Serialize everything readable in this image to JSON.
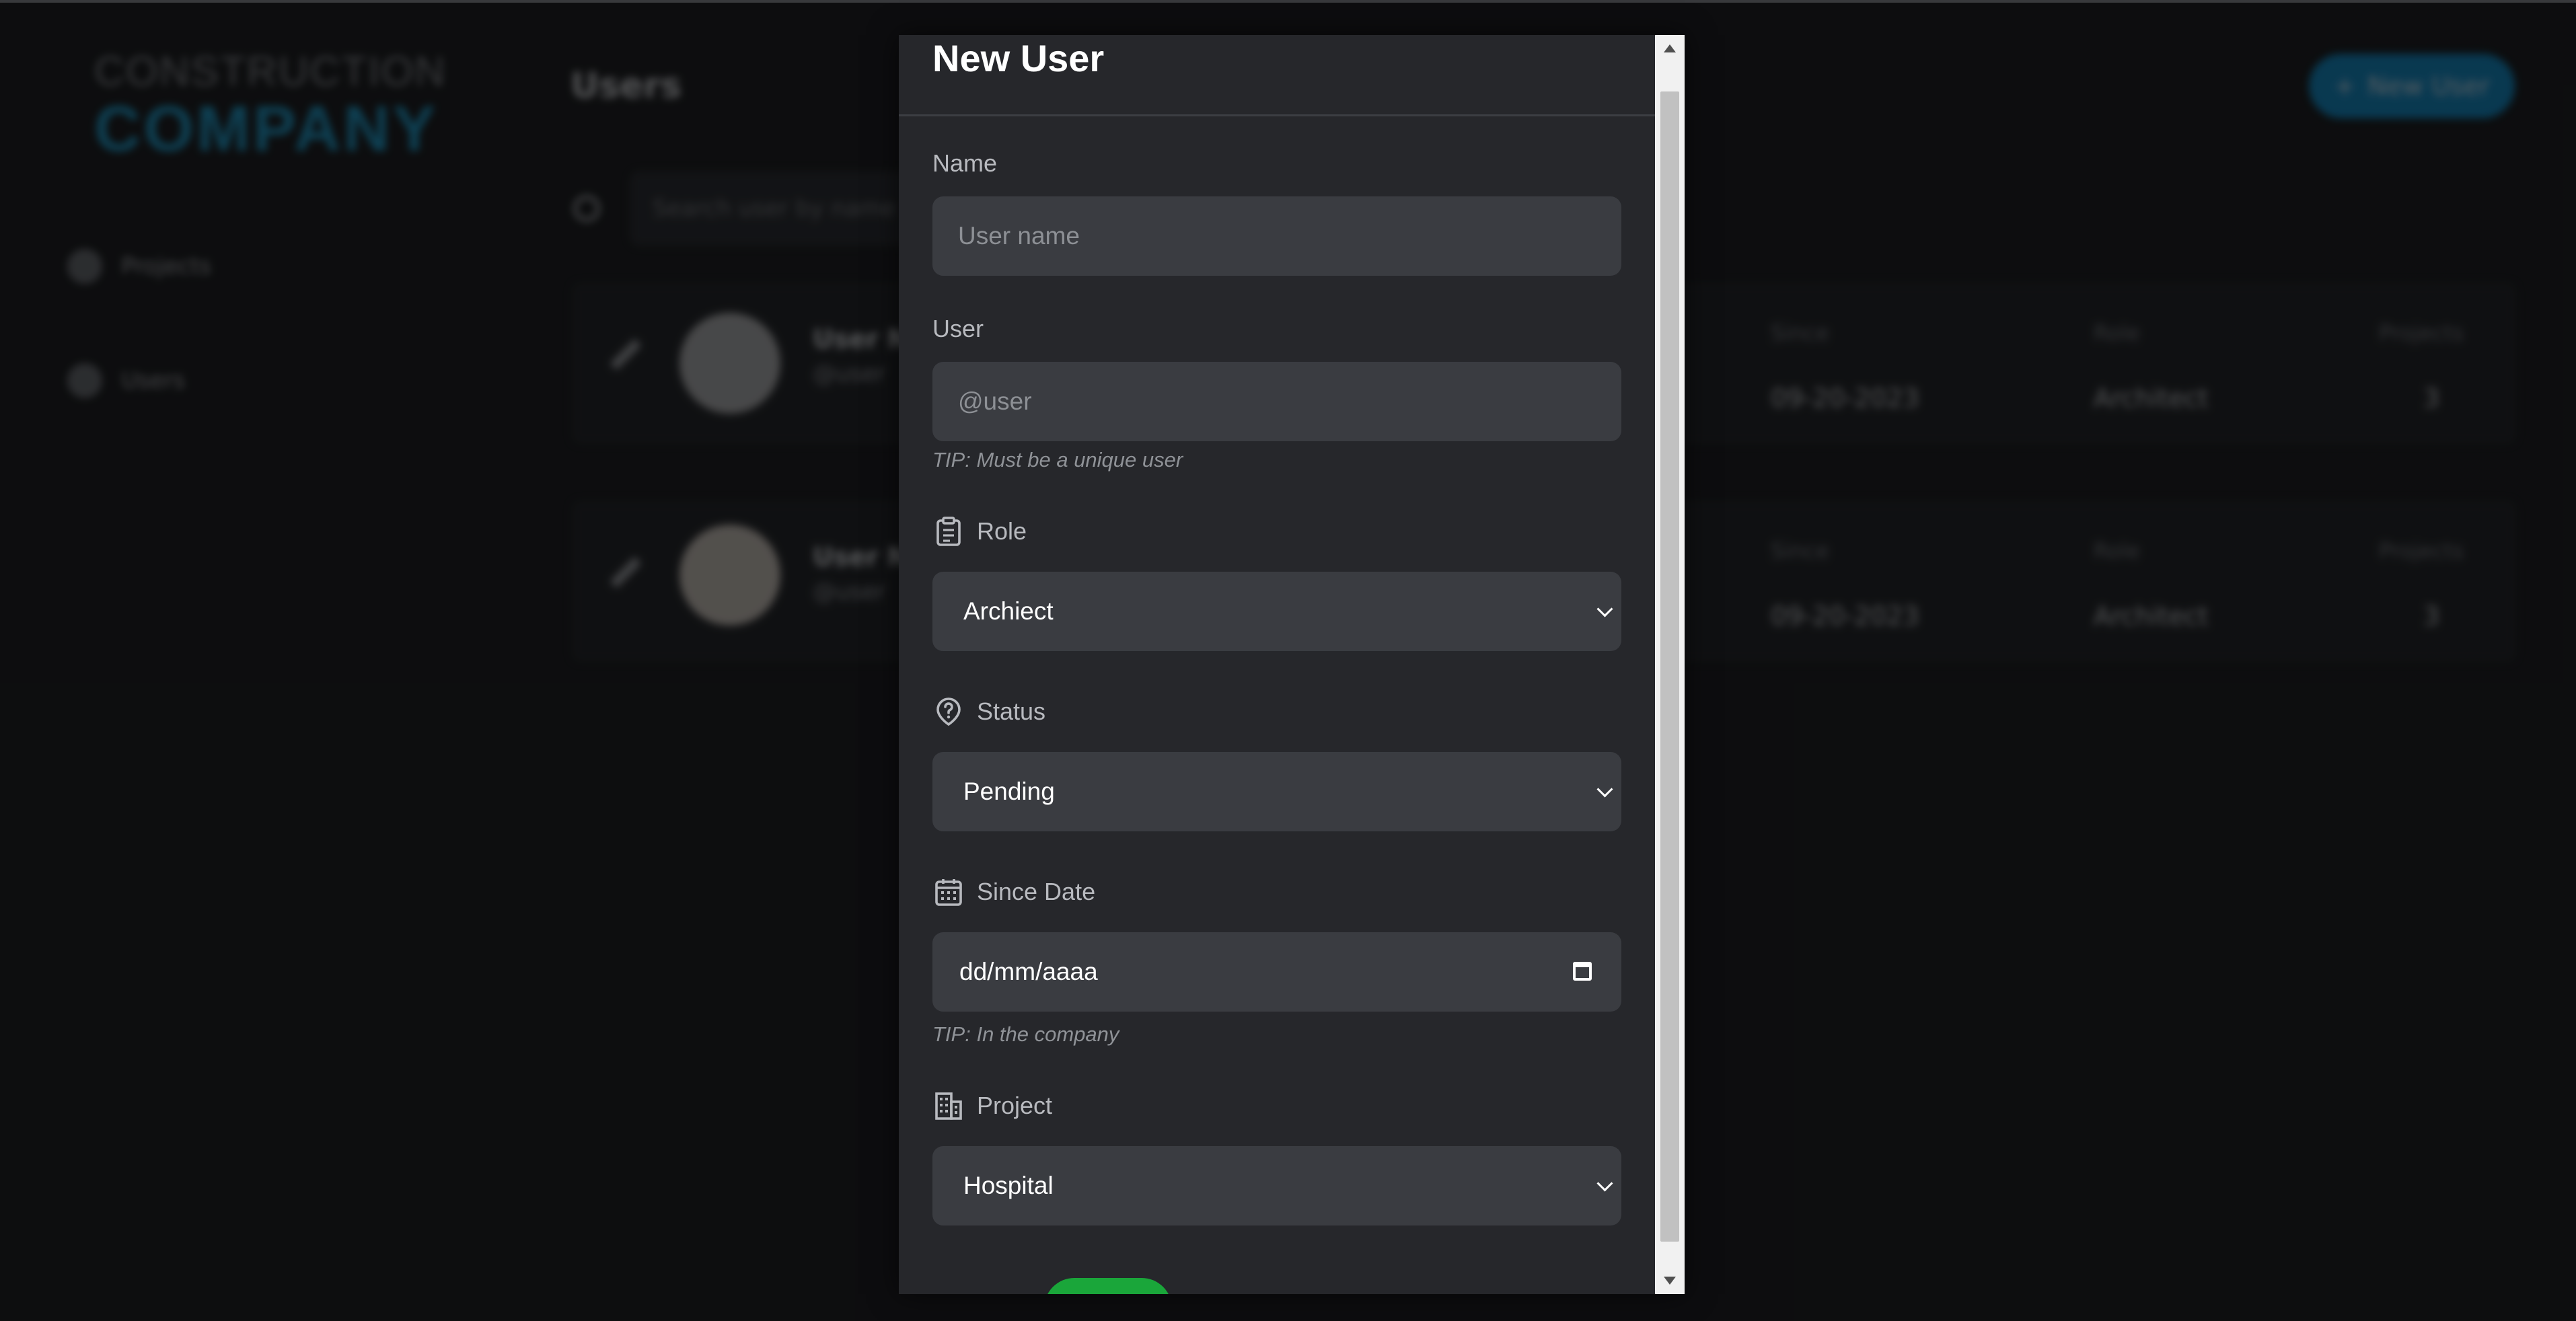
{
  "background": {
    "logo": {
      "line1": "CONSTRUCTION",
      "line2": "COMPANY"
    },
    "sidebar": {
      "items": [
        {
          "label": "Projects",
          "icon": "building-icon"
        },
        {
          "label": "Users",
          "icon": "users-icon"
        }
      ]
    },
    "page_title": "Users",
    "new_user_button": "New User",
    "search_placeholder": "Search user by name",
    "columns": {
      "since": "Since",
      "role": "Role",
      "projects": "Projects"
    },
    "users": [
      {
        "name": "User N",
        "handle": "@user",
        "since": "09-20-2023",
        "role": "Architect",
        "projects": "3"
      },
      {
        "name": "User N",
        "handle": "@user",
        "since": "09-20-2023",
        "role": "Architect",
        "projects": "3"
      }
    ]
  },
  "modal": {
    "title": "New User",
    "name_label": "Name",
    "name_placeholder": "User name",
    "user_label": "User",
    "user_placeholder": "@user",
    "user_tip": "TIP: Must be a unique user",
    "role_label": "Role",
    "role_value": "Archiect",
    "status_label": "Status",
    "status_value": "Pending",
    "since_label": "Since Date",
    "since_value": "dd/mm/aaaa",
    "since_tip": "TIP: In the company",
    "project_label": "Project",
    "project_value": "Hospital"
  },
  "colors": {
    "accent": "#1aa3d6",
    "button_blue": "#0a8fd0",
    "save_green": "#1aa63a",
    "modal_bg": "#26272b",
    "field_bg": "#3a3c41"
  }
}
